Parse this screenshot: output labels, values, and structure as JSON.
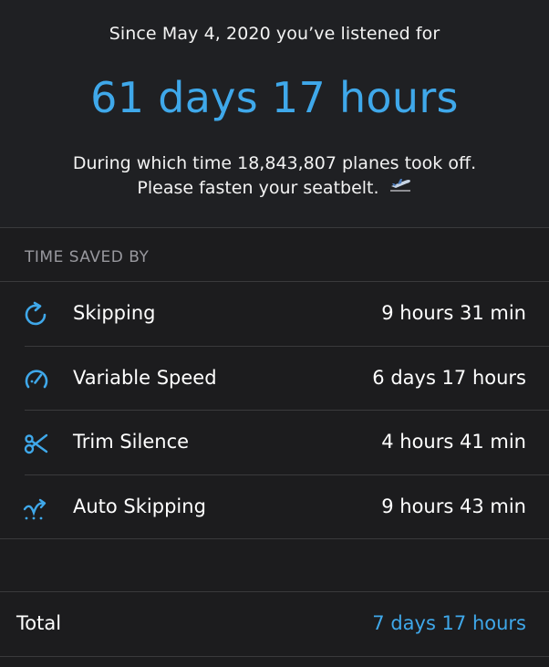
{
  "header": {
    "since_text": "Since May 4, 2020 you’ve listened for",
    "listened_total": "61 days 17 hours",
    "during_line1": "During which time 18,843,807 planes took off.",
    "during_line2": "Please fasten your seatbelt.",
    "airplane_icon": "airplane-departure-icon"
  },
  "section": {
    "title": "TIME SAVED BY"
  },
  "rows": [
    {
      "icon": "skip-forward-icon",
      "label": "Skipping",
      "value": "9 hours 31 min"
    },
    {
      "icon": "speedometer-icon",
      "label": "Variable Speed",
      "value": "6 days 17 hours"
    },
    {
      "icon": "scissors-icon",
      "label": "Trim Silence",
      "value": "4 hours 41 min"
    },
    {
      "icon": "auto-skip-icon",
      "label": "Auto Skipping",
      "value": "9 hours 43 min"
    }
  ],
  "total": {
    "label": "Total",
    "value": "7 days 17 hours"
  },
  "colors": {
    "accent": "#3fa8ea",
    "background": "#1c1c1e",
    "divider": "#3a3a3c",
    "secondary_text": "#98989e"
  }
}
